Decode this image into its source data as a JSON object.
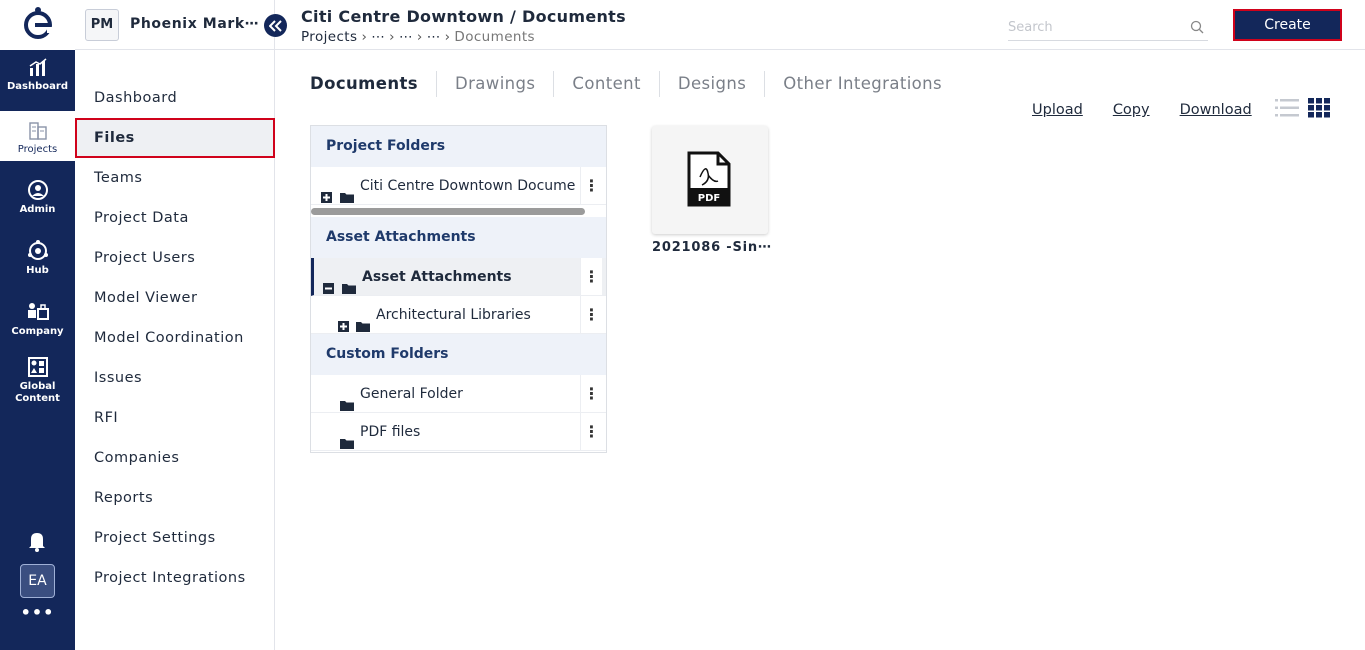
{
  "rail": {
    "items": [
      {
        "label": "Dashboard",
        "icon": "chart-icon"
      },
      {
        "label": "Projects",
        "icon": "buildings-icon"
      },
      {
        "label": "Admin",
        "icon": "user-gear-icon"
      },
      {
        "label": "Hub",
        "icon": "hub-icon"
      },
      {
        "label": "Company",
        "icon": "company-icon"
      },
      {
        "label": "Global",
        "label2": "Content",
        "icon": "grid-shapes-icon"
      }
    ],
    "avatar": "EA",
    "more": "•••"
  },
  "project": {
    "badge": "PM",
    "name": "Phoenix Mark⋯"
  },
  "sidebar": {
    "items": [
      "Dashboard",
      "Files",
      "Teams",
      "Project Data",
      "Project Users",
      "Model Viewer",
      "Model Coordination",
      "Issues",
      "RFI",
      "Companies",
      "Reports",
      "Project Settings",
      "Project Integrations"
    ]
  },
  "header": {
    "title": "Citi Centre Downtown / Documents",
    "breadcrumb": [
      "Projects",
      "⋯",
      "⋯",
      "⋯",
      "Documents"
    ],
    "search_placeholder": "Search",
    "create_label": "Create"
  },
  "tabs": [
    "Documents",
    "Drawings",
    "Content",
    "Designs",
    "Other Integrations"
  ],
  "actions": [
    "Upload",
    "Copy",
    "Download"
  ],
  "tree": {
    "sections": [
      {
        "title": "Project Folders",
        "rows": [
          {
            "label": "Citi Centre Downtown Docume"
          }
        ]
      },
      {
        "title": "Asset Attachments",
        "rows": [
          {
            "label": "Asset Attachments"
          },
          {
            "label": "Architectural Libraries"
          }
        ]
      },
      {
        "title": "Custom Folders",
        "rows": [
          {
            "label": "General Folder"
          },
          {
            "label": "PDF files"
          }
        ]
      }
    ]
  },
  "file": {
    "name": "2021086 -Sin⋯",
    "type_label": "PDF"
  },
  "colors": {
    "navy": "#13275a",
    "highlight": "#d0021b"
  }
}
